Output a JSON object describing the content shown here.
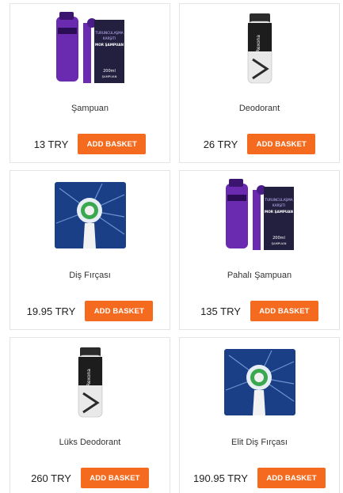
{
  "products": [
    {
      "name": "Şampuan",
      "price": "13 TRY",
      "button": "ADD BASKET",
      "image": "purple-shampoo"
    },
    {
      "name": "Deodorant",
      "price": "26 TRY",
      "button": "ADD BASKET",
      "image": "rexona-deodorant"
    },
    {
      "name": "Diş Fırçası",
      "price": "19.95 TRY",
      "button": "ADD BASKET",
      "image": "toothbrush-head"
    },
    {
      "name": "Pahalı Şampuan",
      "price": "135 TRY",
      "button": "ADD BASKET",
      "image": "purple-shampoo"
    },
    {
      "name": "Lüks Deodorant",
      "price": "260 TRY",
      "button": "ADD BASKET",
      "image": "rexona-deodorant"
    },
    {
      "name": "Elit Diş Fırçası",
      "price": "190.95 TRY",
      "button": "ADD BASKET",
      "image": "toothbrush-head"
    }
  ],
  "image_text": {
    "shampoo_brand": "ELSEVIER",
    "shampoo_box_line1": "TURUNCULAŞMA",
    "shampoo_box_line2": "KARŞITI",
    "shampoo_box_line3": "MOR ŞAMPUAN",
    "shampoo_box_size": "200ml",
    "shampoo_box_size2": "ŞAMPUAN",
    "deodorant_brand": "Rexona"
  },
  "colors": {
    "button": "#f46b1f",
    "card_border": "#e4e4e4",
    "shampoo_purple": "#6a2bb0",
    "toothbrush_bg": "#1b3f86"
  }
}
